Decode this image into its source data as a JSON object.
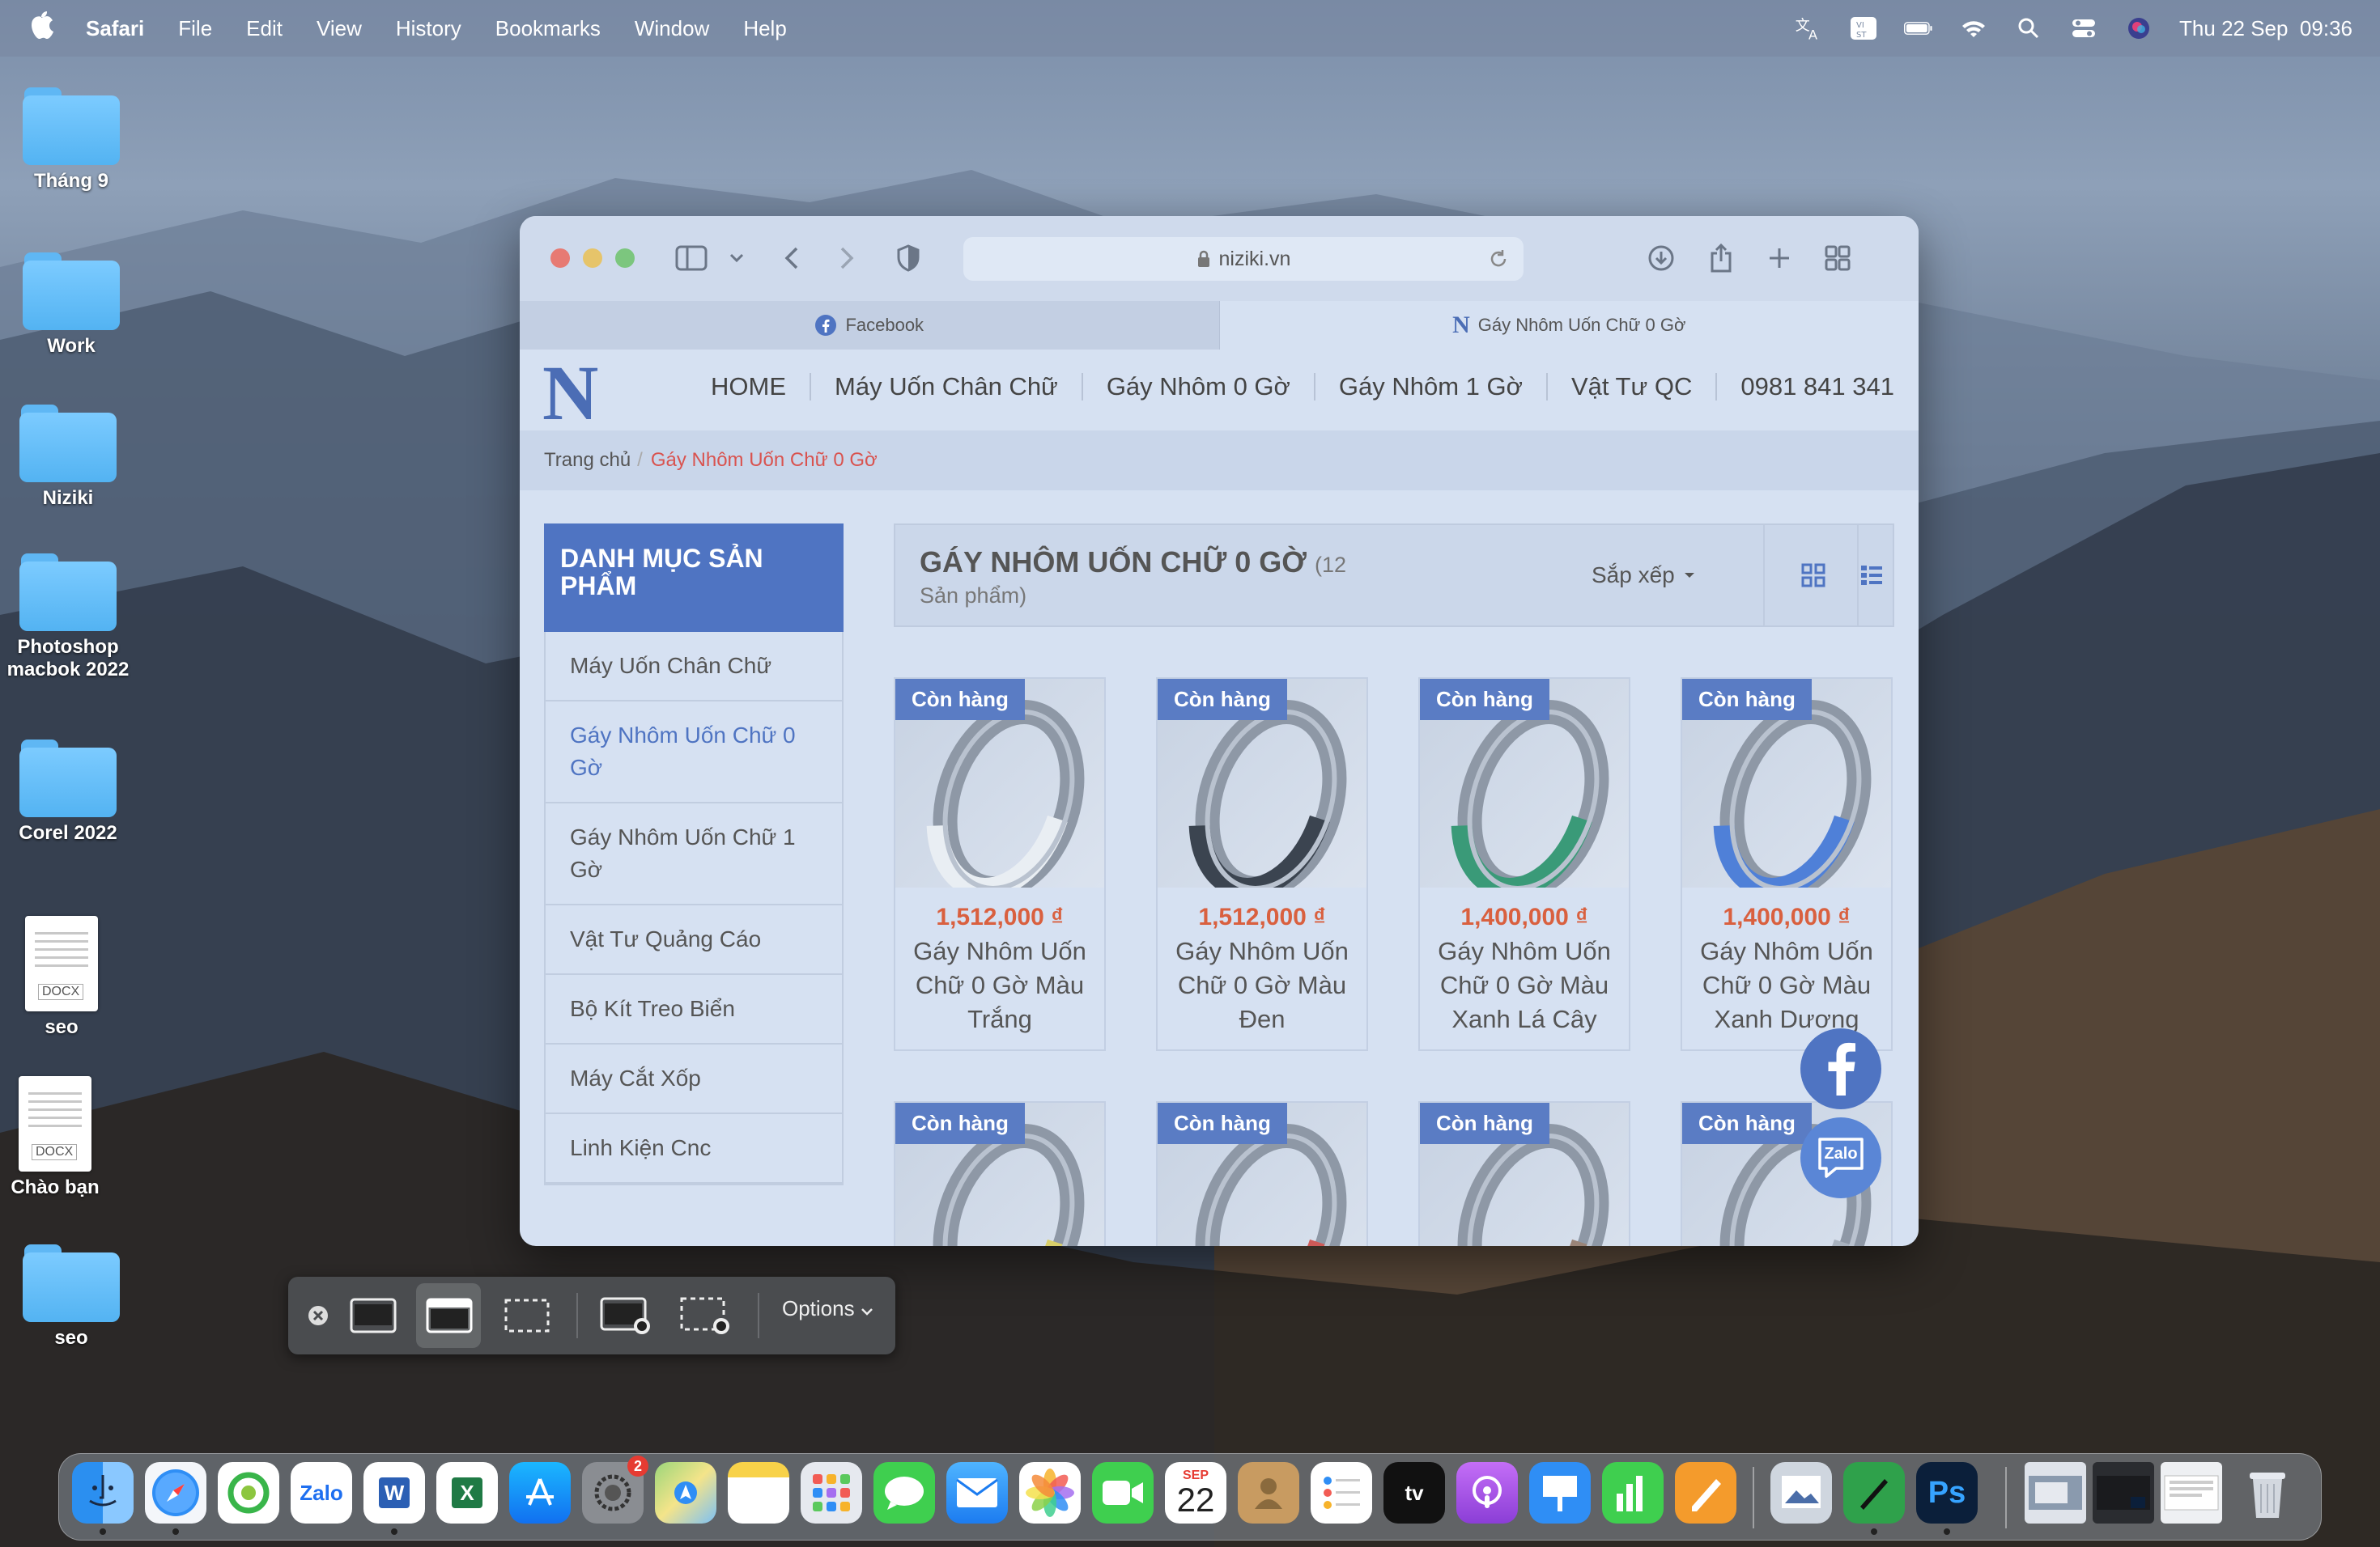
{
  "menubar": {
    "app": "Safari",
    "items": [
      "File",
      "Edit",
      "View",
      "History",
      "Bookmarks",
      "Window",
      "Help"
    ],
    "datetime": "Thu 22 Sep  09:36"
  },
  "desktop": {
    "icons": [
      {
        "label": "Tháng 9",
        "kind": "folder"
      },
      {
        "label": "Work",
        "kind": "folder"
      },
      {
        "label": "Niziki",
        "kind": "folder"
      },
      {
        "label": "Photoshop macbok 2022",
        "kind": "folder"
      },
      {
        "label": "Corel 2022",
        "kind": "folder"
      },
      {
        "label": "seo",
        "kind": "docx",
        "tag": "DOCX"
      },
      {
        "label": "Chào bạn",
        "kind": "docx",
        "tag": "DOCX"
      },
      {
        "label": "seo",
        "kind": "folder"
      }
    ]
  },
  "browser": {
    "url": "niziki.vn",
    "tabs": [
      {
        "label": "Facebook",
        "icon": "facebook-icon"
      },
      {
        "label": "Gáy Nhôm Uốn Chữ 0 Gờ",
        "icon": "niziki-logo-icon"
      }
    ]
  },
  "site": {
    "logo": "N",
    "nav": [
      "HOME",
      "Máy Uốn Chân Chữ",
      "Gáy Nhôm 0 Gờ",
      "Gáy Nhôm 1 Gờ",
      "Vật Tư QC",
      "0981 841 341"
    ],
    "breadcrumb": {
      "home": "Trang chủ",
      "sep": "/",
      "current": "Gáy Nhôm Uốn Chữ 0 Gờ"
    },
    "sidebar": {
      "title": "DANH MỤC SẢN PHẨM",
      "items": [
        "Máy Uốn Chân Chữ",
        "Gáy Nhôm Uốn Chữ 0 Gờ",
        "Gáy Nhôm Uốn Chữ 1 Gờ",
        "Vật Tư Quảng Cáo",
        "Bộ Kít Treo Biển",
        "Máy Cắt Xốp",
        "Linh Kiện Cnc"
      ],
      "selected_index": 1
    },
    "listing": {
      "title": "GÁY NHÔM UỐN CHỮ 0 GỜ",
      "count": "(12",
      "count_unit": "Sản phẩm)",
      "sort_label": "Sắp xếp"
    },
    "products": [
      {
        "badge": "Còn hàng",
        "price": "1,512,000 ₫",
        "name": "Gáy Nhôm Uốn Chữ 0 Gờ Màu Trắng",
        "color": "#e9eef3"
      },
      {
        "badge": "Còn hàng",
        "price": "1,512,000 ₫",
        "name": "Gáy Nhôm Uốn Chữ 0 Gờ Màu Đen",
        "color": "#3b4450"
      },
      {
        "badge": "Còn hàng",
        "price": "1,400,000 ₫",
        "name": "Gáy Nhôm Uốn Chữ 0 Gờ Màu Xanh Lá Cây",
        "color": "#3a9a78"
      },
      {
        "badge": "Còn hàng",
        "price": "1,400,000 ₫",
        "name": "Gáy Nhôm Uốn Chữ 0 Gờ Màu Xanh Dương",
        "color": "#4f80d8"
      },
      {
        "badge": "Còn hàng",
        "color": "#d9cf6a"
      },
      {
        "badge": "Còn hàng",
        "color": "#cf5a58"
      },
      {
        "badge": "Còn hàng",
        "color": "#9a8478"
      },
      {
        "badge": "Còn hàng",
        "color": "#a9b3bf"
      }
    ],
    "floating": {
      "zalo": "Zalo"
    }
  },
  "screenshot_toolbar": {
    "options": "Options"
  },
  "dock": {
    "apps": [
      "Finder",
      "Safari",
      "CocCoc",
      "Zalo",
      "Word",
      "Excel",
      "App Store",
      "System Preferences",
      "Maps",
      "Notes",
      "Launchpad",
      "Messages",
      "Mail",
      "Photos",
      "FaceTime",
      "Calendar",
      "Contacts",
      "Reminders",
      "TV",
      "Podcasts",
      "Keynote",
      "Numbers",
      "Pages",
      "Preview",
      "Wacom",
      "Photoshop",
      "Recent 1",
      "Recent 2",
      "Recent 3",
      "Trash"
    ],
    "calendar_month": "SEP",
    "calendar_day": "22",
    "settings_badge": "2",
    "zalo_label": "Zalo",
    "word_label": "W",
    "excel_label": "X",
    "ps_label": "Ps",
    "tv_label": "tv"
  }
}
